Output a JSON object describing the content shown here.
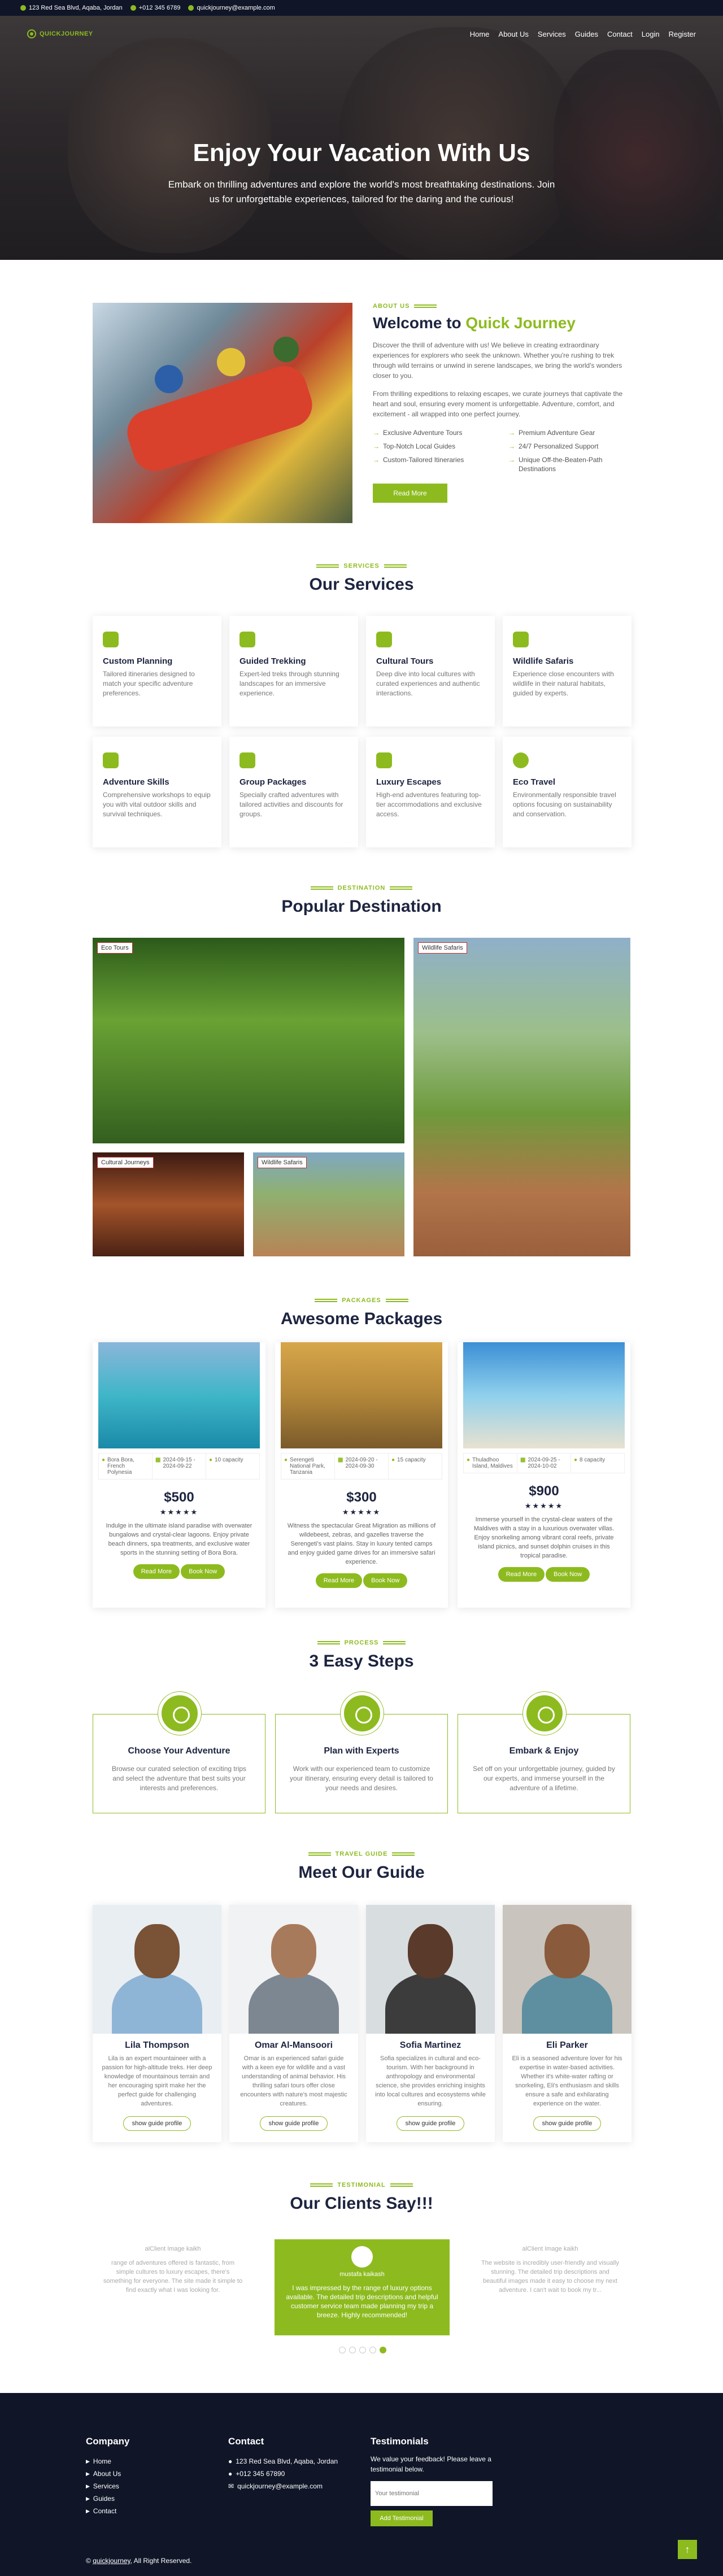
{
  "topbar": {
    "address": "123 Red Sea Blvd, Aqaba, Jordan",
    "phone": "+012 345 6789",
    "email": "quickjourney@example.com"
  },
  "brand": {
    "name_a": "QUICK",
    "name_b": "JOURNEY",
    "accent": "#8dbb1f",
    "dark": "#101628"
  },
  "nav": [
    "Home",
    "About Us",
    "Services",
    "Guides",
    "Contact",
    "Login",
    "Register"
  ],
  "hero": {
    "title": "Enjoy Your Vacation With Us",
    "subtitle": "Embark on thrilling adventures and explore the world's most breathtaking destinations. Join us for unforgettable experiences, tailored for the daring and the curious!"
  },
  "about": {
    "eyebrow": "ABOUT US",
    "title_a": "Welcome to ",
    "title_b": "Quick Journey",
    "p1": "Discover the thrill of adventure with us! We believe in creating extraordinary experiences for explorers who seek the unknown. Whether you're rushing to trek through wild terrains or unwind in serene landscapes, we bring the world's wonders closer to you.",
    "p2": "From thrilling expeditions to relaxing escapes, we curate journeys that captivate the heart and soul, ensuring every moment is unforgettable. Adventure, comfort, and excitement - all wrapped into one perfect journey.",
    "features": [
      "Exclusive Adventure Tours",
      "Premium Adventure Gear",
      "Top-Notch Local Guides",
      "24/7 Personalized Support",
      "Custom-Tailored Itineraries",
      "Unique Off-the-Beaten-Path Destinations"
    ],
    "button": "Read More"
  },
  "services": {
    "eyebrow": "SERVICES",
    "title": "Our Services",
    "items": [
      {
        "icon": "gear-icon",
        "title": "Custom Planning",
        "desc": "Tailored itineraries designed to match your specific adventure preferences."
      },
      {
        "icon": "hiker-icon",
        "title": "Guided Trekking",
        "desc": "Expert-led treks through stunning landscapes for an immersive experience."
      },
      {
        "icon": "temple-icon",
        "title": "Cultural Tours",
        "desc": "Deep dive into local cultures with curated experiences and authentic interactions."
      },
      {
        "icon": "gear-icon",
        "title": "Wildlife Safaris",
        "desc": "Experience close encounters with wildlife in their natural habitats, guided by experts."
      },
      {
        "icon": "gear-icon",
        "title": "Adventure Skills",
        "desc": "Comprehensive workshops to equip you with vital outdoor skills and survival techniques."
      },
      {
        "icon": "group-icon",
        "title": "Group Packages",
        "desc": "Specially crafted adventures with tailored activities and discounts for groups."
      },
      {
        "icon": "temple-icon",
        "title": "Luxury Escapes",
        "desc": "High-end adventures featuring top-tier accommodations and exclusive access."
      },
      {
        "icon": "globe-icon",
        "title": "Eco Travel",
        "desc": "Environmentally responsible travel options focusing on sustainability and conservation."
      }
    ]
  },
  "destination": {
    "eyebrow": "DESTINATION",
    "title": "Popular Destination",
    "tags": [
      "Eco Tours",
      "Wildlife Safaris",
      "Cultural Journeys",
      "Wildlife Safaris"
    ]
  },
  "packages": {
    "eyebrow": "PACKAGES",
    "title": "Awesome Packages",
    "items": [
      {
        "location": "Bora Bora, French Polynesia",
        "date": "2024-09-15 - 2024-09-22",
        "cap": "10 capacity",
        "price": "$500",
        "stars": "★★★★★",
        "desc": "Indulge in the ultimate island paradise with overwater bungalows and crystal-clear lagoons. Enjoy private beach dinners, spa treatments, and exclusive water sports in the stunning setting of Bora Bora."
      },
      {
        "location": "Serengeti National Park, Tanzania",
        "date": "2024-09-20 - 2024-09-30",
        "cap": "15 capacity",
        "price": "$300",
        "stars": "★★★★★",
        "desc": "Witness the spectacular Great Migration as millions of wildebeest, zebras, and gazelles traverse the Serengeti's vast plains. Stay in luxury tented camps and enjoy guided game drives for an immersive safari experience."
      },
      {
        "location": "Thuladhoo Island, Maldives",
        "date": "2024-09-25 - 2024-10-02",
        "cap": "8 capacity",
        "price": "$900",
        "stars": "★★★★★",
        "desc": "Immerse yourself in the crystal-clear waters of the Maldives with a stay in a luxurious overwater villas. Enjoy snorkeling among vibrant coral reefs, private island picnics, and sunset dolphin cruises in this tropical paradise."
      }
    ],
    "btn_read": "Read More",
    "btn_book": "Book Now"
  },
  "process": {
    "eyebrow": "PROCESS",
    "title": "3 Easy Steps",
    "items": [
      {
        "title": "Choose Your Adventure",
        "desc": "Browse our curated selection of exciting trips and select the adventure that best suits your interests and preferences."
      },
      {
        "title": "Plan with Experts",
        "desc": "Work with our experienced team to customize your itinerary, ensuring every detail is tailored to your needs and desires."
      },
      {
        "title": "Embark & Enjoy",
        "desc": "Set off on your unforgettable journey, guided by our experts, and immerse yourself in the adventure of a lifetime."
      }
    ]
  },
  "guides": {
    "eyebrow": "TRAVEL GUIDE",
    "title": "Meet Our Guide",
    "btn": "show guide profile",
    "items": [
      {
        "name": "Lila Thompson",
        "desc": "Lila is an expert mountaineer with a passion for high-altitude treks. Her deep knowledge of mountainous terrain and her encouraging spirit make her the perfect guide for challenging adventures."
      },
      {
        "name": "Omar Al-Mansoori",
        "desc": "Omar is an experienced safari guide with a keen eye for wildlife and a vast understanding of animal behavior. His thrilling safari tours offer close encounters with nature's most majestic creatures."
      },
      {
        "name": "Sofia Martinez",
        "desc": "Sofia specializes in cultural and eco-tourism. With her background in anthropology and environmental science, she provides enriching insights into local cultures and ecosystems while ensuring."
      },
      {
        "name": "Eli Parker",
        "desc": "Eli is a seasoned adventure lover for his expertise in water-based activities. Whether it's white-water rafting or snorkeling, Eli's enthusiasm and skills ensure a safe and exhilarating experience on the water."
      }
    ]
  },
  "testimonial": {
    "eyebrow": "TESTIMONIAL",
    "title": "Our Clients Say!!!",
    "items": [
      {
        "avatar": "alClient Image kaikh",
        "name": "",
        "text": "range of adventures offered is fantastic, from simple cultures to luxury escapes, there's something for everyone. The site made it simple to find exactly what I was looking for."
      },
      {
        "avatar": "",
        "name": "mustafa kaikash",
        "text": "I was impressed by the range of luxury options available. The detailed trip descriptions and helpful customer service team made planning my trip a breeze. Highly recommended!"
      },
      {
        "avatar": "alClient Image kaikh",
        "name": "",
        "text": "The website is incredibly user-friendly and visually stunning. The detailed trip descriptions and beautiful images made it easy to choose my next adventure. I can't wait to book my tr..."
      }
    ]
  },
  "footer": {
    "company": "Company",
    "links": [
      "Home",
      "About Us",
      "Services",
      "Guides",
      "Contact"
    ],
    "contact": "Contact",
    "address": "123 Red Sea Blvd, Aqaba, Jordan",
    "phone": "+012 345 67890",
    "email": "quickjourney@example.com",
    "testimonials": "Testimonials",
    "t_text": "We value your feedback! Please leave a testimonial below.",
    "t_placeholder": "Your testimonial",
    "t_button": "Add Testimonial",
    "copyright_a": "© ",
    "copyright_b": "quickjourney",
    "copyright_c": ", All Right Reserved."
  }
}
